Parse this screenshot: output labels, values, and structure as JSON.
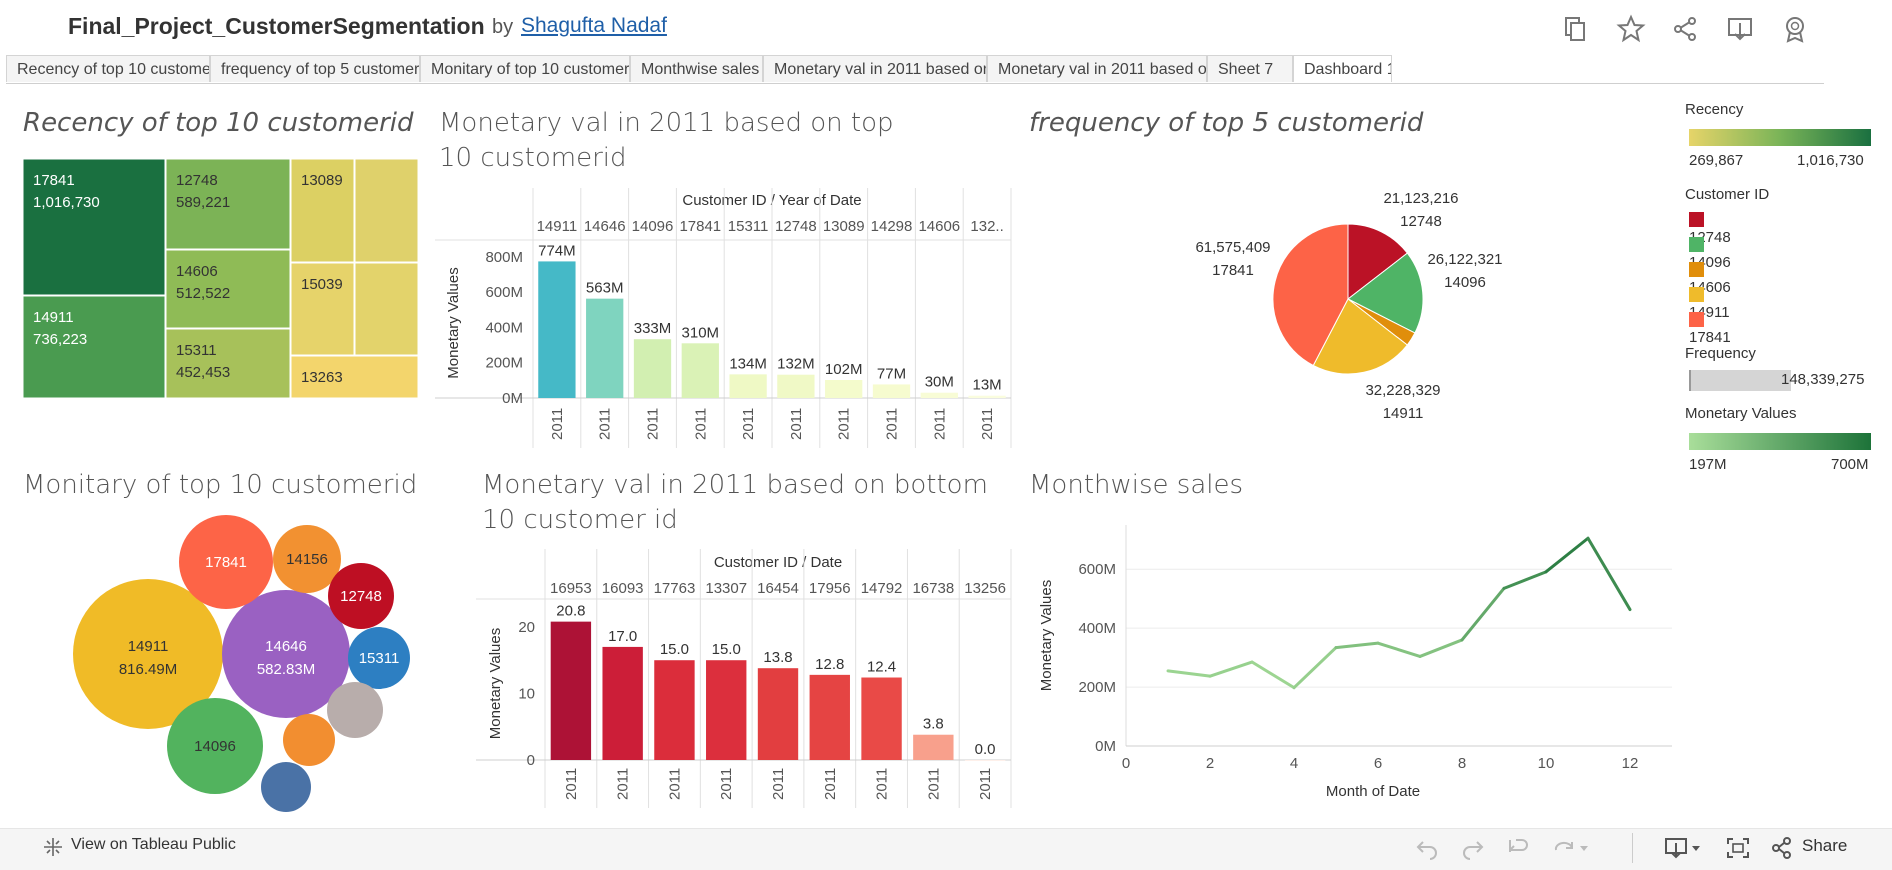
{
  "header": {
    "title": "Final_Project_CustomerSegmentation",
    "by": "by",
    "author": "Shagufta Nadaf",
    "icons": [
      "copy-icon",
      "star-icon",
      "share-network-icon",
      "download-icon",
      "badge-icon"
    ]
  },
  "tabs": [
    {
      "label": "Recency of top 10 customerid",
      "active": false
    },
    {
      "label": "frequency of top 5 customerid",
      "active": false
    },
    {
      "label": "Monitary of top 10 customerid",
      "active": false
    },
    {
      "label": "Monthwise sales",
      "active": false
    },
    {
      "label": "Monetary val in 2011 based on ...",
      "active": false
    },
    {
      "label": "Monetary val in 2011 based on ...",
      "active": false
    },
    {
      "label": "Sheet 7",
      "active": false
    },
    {
      "label": "Dashboard 1",
      "active": true
    }
  ],
  "recency": {
    "title": "Recency of top 10 customerid",
    "cells": [
      {
        "id": "17841",
        "value": "1,016,730",
        "color": "#1a7040"
      },
      {
        "id": "14911",
        "value": "736,223",
        "color": "#4a9b50"
      },
      {
        "id": "12748",
        "value": "589,221",
        "color": "#7cb356"
      },
      {
        "id": "14606",
        "value": "512,522",
        "color": "#8fbb56"
      },
      {
        "id": "15311",
        "value": "452,453",
        "color": "#a7c15a"
      },
      {
        "id": "13089",
        "value": "",
        "color": "#dcd063"
      },
      {
        "id": "",
        "value": "",
        "color": "#dfd16b"
      },
      {
        "id": "15039",
        "value": "",
        "color": "#e6d36a"
      },
      {
        "id": "",
        "value": "",
        "color": "#e3d36b"
      },
      {
        "id": "13263",
        "value": "",
        "color": "#f3d56c"
      }
    ]
  },
  "chart_data": [
    {
      "type": "bar",
      "title": "Monetary val in 2011 based on top 10 customerid",
      "header": "Customer ID / Year of Date",
      "ylabel": "Monetary Values",
      "categories": [
        "14911",
        "14646",
        "14096",
        "17841",
        "15311",
        "12748",
        "13089",
        "14298",
        "14606",
        "132.."
      ],
      "x_sub": "2011",
      "values": [
        774,
        563,
        333,
        310,
        134,
        132,
        102,
        77,
        30,
        13
      ],
      "value_labels": [
        "774M",
        "563M",
        "333M",
        "310M",
        "134M",
        "132M",
        "102M",
        "77M",
        "30M",
        "13M"
      ],
      "colors": [
        "#45b9c7",
        "#7fd4bf",
        "#d2efb1",
        "#daf2b6",
        "#eff9c5",
        "#f0f9c6",
        "#f4fbcc",
        "#f6fbcf",
        "#f8fcd6",
        "#fafdde"
      ],
      "yticks": [
        "0M",
        "200M",
        "400M",
        "600M",
        "800M"
      ],
      "ylim": [
        0,
        850
      ]
    },
    {
      "type": "pie",
      "title": "frequency of top 5 customerid",
      "slices": [
        {
          "id": "12748",
          "value": 21123216,
          "label": "21,123,216",
          "color": "#bb1226"
        },
        {
          "id": "14096",
          "value": 26122321,
          "label": "26,122,321",
          "color": "#4fb466"
        },
        {
          "id": "14606",
          "value": 4400000,
          "label": "",
          "color": "#e08e0b"
        },
        {
          "id": "14911",
          "value": 32228329,
          "label": "32,228,329",
          "color": "#efbb2b"
        },
        {
          "id": "17841",
          "value": 61575409,
          "label": "61,575,409",
          "color": "#fd6347"
        }
      ]
    },
    {
      "type": "bar",
      "title": "Monetary val in 2011 based on bottom 10 customer id",
      "header": "Customer ID / Date",
      "ylabel": "Monetary Values",
      "categories": [
        "16953",
        "16093",
        "17763",
        "13307",
        "16454",
        "17956",
        "14792",
        "16738",
        "13256"
      ],
      "x_sub": "2011",
      "values": [
        20.8,
        17.0,
        15.0,
        15.0,
        13.8,
        12.8,
        12.4,
        3.8,
        0.0
      ],
      "value_labels": [
        "20.8",
        "17.0",
        "15.0",
        "15.0",
        "13.8",
        "12.8",
        "12.4",
        "3.8",
        "0.0"
      ],
      "colors": [
        "#ad1236",
        "#cc1e38",
        "#db2d3b",
        "#dc2f3d",
        "#e23e40",
        "#e54443",
        "#e94a47",
        "#f8a08c",
        "#fde0d6"
      ],
      "yticks": [
        "0",
        "10",
        "20"
      ],
      "ylim": [
        0,
        23
      ]
    },
    {
      "type": "line",
      "title": "Monthwise sales",
      "xlabel": "Month of Date",
      "ylabel": "Monetary Values",
      "x": [
        1,
        2,
        3,
        4,
        5,
        6,
        7,
        8,
        9,
        10,
        11,
        12
      ],
      "y": [
        255,
        237,
        285,
        198,
        334,
        349,
        304,
        360,
        535,
        591,
        705,
        463
      ],
      "xticks": [
        "0",
        "2",
        "4",
        "6",
        "8",
        "10",
        "12"
      ],
      "yticks": [
        "0M",
        "200M",
        "400M",
        "600M"
      ],
      "xlim": [
        0,
        13
      ],
      "ylim": [
        0,
        750
      ]
    }
  ],
  "monitary": {
    "title": "Monitary of top 10 customerid",
    "bubbles": [
      {
        "id": "14911",
        "value": "816.49M",
        "color": "#f0bb27"
      },
      {
        "id": "14646",
        "value": "582.83M",
        "color": "#9a61c2"
      },
      {
        "id": "17841",
        "value": "",
        "color": "#fd6447"
      },
      {
        "id": "14156",
        "value": "",
        "color": "#f29131"
      },
      {
        "id": "12748",
        "value": "",
        "color": "#be0f23"
      },
      {
        "id": "15311",
        "value": "",
        "color": "#2d7fc2"
      },
      {
        "id": "14096",
        "value": "",
        "color": "#52b35e"
      },
      {
        "id": "",
        "value": "",
        "color": "#b8adab"
      },
      {
        "id": "",
        "value": "",
        "color": "#f28e30"
      },
      {
        "id": "",
        "value": "",
        "color": "#4a72a6"
      }
    ]
  },
  "legends": {
    "recency": {
      "title": "Recency",
      "min": "269,867",
      "max": "1,016,730"
    },
    "customer": {
      "title": "Customer ID",
      "items": [
        {
          "label": "12748",
          "color": "#bb1226"
        },
        {
          "label": "14096",
          "color": "#4fb466"
        },
        {
          "label": "14606",
          "color": "#e08e0b"
        },
        {
          "label": "14911",
          "color": "#efbb2b"
        },
        {
          "label": "17841",
          "color": "#fd6347"
        }
      ]
    },
    "frequency": {
      "title": "Frequency",
      "value": "148,339,275"
    },
    "monetary": {
      "title": "Monetary Values",
      "min": "197M",
      "max": "700M"
    }
  },
  "toolbar": {
    "view_label": "View on Tableau Public",
    "share_label": "Share"
  }
}
